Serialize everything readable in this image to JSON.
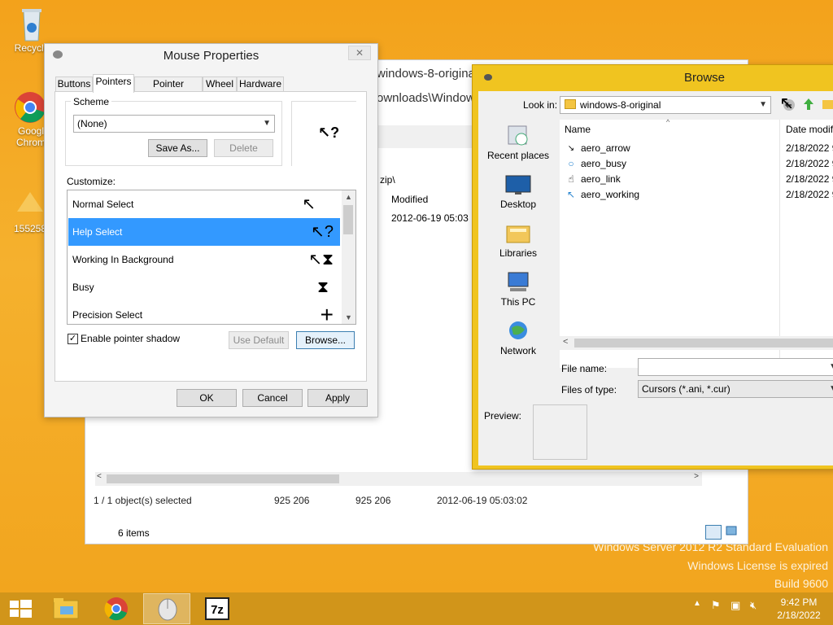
{
  "desktop": {
    "icons": [
      {
        "label": "Recycle"
      },
      {
        "label": "Googl Chrom"
      },
      {
        "label": "155258"
      }
    ],
    "watermark": [
      "Windows Server 2012 R2 Standard Evaluation",
      "Windows License is expired",
      "Build 9600"
    ]
  },
  "explorer": {
    "path_title": "windows-8-origina",
    "path_addr": "ownloads\\Window",
    "zip_text": "zip\\",
    "col_modified": "Modified",
    "row_modified": "2012-06-19 05:03",
    "status": {
      "selected": "1 / 1 object(s) selected",
      "size1": "925 206",
      "size2": "925 206",
      "date": "2012-06-19 05:03:02"
    },
    "items_count": "6 items"
  },
  "mouse_props": {
    "title": "Mouse Properties",
    "tabs": [
      "Buttons",
      "Pointers",
      "Pointer Options",
      "Wheel",
      "Hardware"
    ],
    "active_tab": "Pointers",
    "scheme_label": "Scheme",
    "scheme_value": "(None)",
    "save_as": "Save As...",
    "delete": "Delete",
    "customize_label": "Customize:",
    "pointers": [
      {
        "name": "Normal Select",
        "glyph": "↖"
      },
      {
        "name": "Help Select",
        "glyph": "↖?"
      },
      {
        "name": "Working In Background",
        "glyph": "↖⧗"
      },
      {
        "name": "Busy",
        "glyph": "⧗"
      },
      {
        "name": "Precision Select",
        "glyph": "+"
      }
    ],
    "selected_pointer": "Help Select",
    "shadow_label": "Enable pointer shadow",
    "shadow_checked": true,
    "use_default": "Use Default",
    "browse": "Browse...",
    "ok": "OK",
    "cancel": "Cancel",
    "apply": "Apply"
  },
  "browse": {
    "title": "Browse",
    "look_in_label": "Look in:",
    "look_in_value": "windows-8-original",
    "places": [
      "Recent places",
      "Desktop",
      "Libraries",
      "This PC",
      "Network"
    ],
    "col_name": "Name",
    "col_date": "Date modif",
    "files": [
      {
        "name": "aero_arrow",
        "date": "2/18/2022 9"
      },
      {
        "name": "aero_busy",
        "date": "2/18/2022 9"
      },
      {
        "name": "aero_link",
        "date": "2/18/2022 9"
      },
      {
        "name": "aero_working",
        "date": "2/18/2022 9"
      }
    ],
    "file_name_label": "File name:",
    "file_name_value": "",
    "files_of_type_label": "Files of type:",
    "files_of_type_value": "Cursors (*.ani, *.cur)",
    "preview_label": "Preview:"
  },
  "taskbar": {
    "time": "9:42 PM",
    "date": "2/18/2022"
  },
  "colors": {
    "desktop": "#f4a71f",
    "taskbar": "#d1951a",
    "selection": "#3399ff",
    "browse_frame": "#f0c420"
  }
}
